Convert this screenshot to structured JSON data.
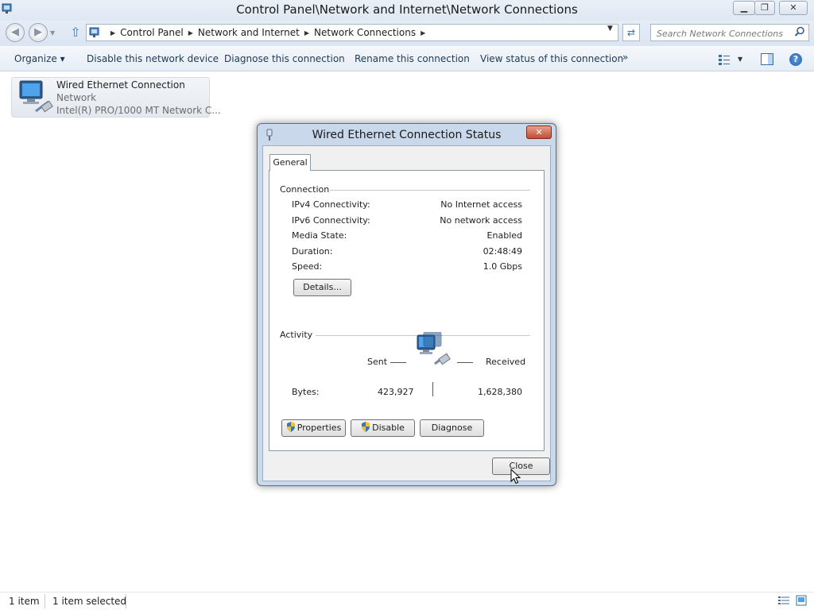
{
  "window": {
    "title": "Control Panel\\Network and Internet\\Network Connections",
    "min_glyph": "▁",
    "max_glyph": "❐",
    "close_glyph": "✕"
  },
  "address": {
    "crumbs": [
      "Control Panel",
      "Network and Internet",
      "Network Connections"
    ],
    "search_placeholder": "Search Network Connections"
  },
  "commands": {
    "organize": "Organize ▾",
    "disable": "Disable this network device",
    "diagnose": "Diagnose this connection",
    "rename": "Rename this connection",
    "view_status": "View status of this connection",
    "more": "»"
  },
  "network_item": {
    "name": "Wired Ethernet Connection",
    "type": "Network",
    "adapter": "Intel(R) PRO/1000 MT Network C..."
  },
  "dialog": {
    "title": "Wired Ethernet Connection Status",
    "tab": "General",
    "connection": {
      "label": "Connection",
      "rows": [
        {
          "label": "IPv4 Connectivity:",
          "value": "No Internet access"
        },
        {
          "label": "IPv6 Connectivity:",
          "value": "No network access"
        },
        {
          "label": "Media State:",
          "value": "Enabled"
        },
        {
          "label": "Duration:",
          "value": "02:48:49"
        },
        {
          "label": "Speed:",
          "value": "1.0 Gbps"
        }
      ],
      "details_button": "Details..."
    },
    "activity": {
      "label": "Activity",
      "sent_label": "Sent",
      "received_label": "Received",
      "bytes_label": "Bytes:",
      "bytes_sent": "423,927",
      "bytes_received": "1,628,380"
    },
    "buttons": {
      "properties": "Properties",
      "disable": "Disable",
      "diagnose": "Diagnose",
      "close": "Close"
    }
  },
  "statusbar": {
    "count": "1 item",
    "selected": "1 item selected"
  },
  "colors": {
    "command_text": "#1e3955",
    "dialog_frame": "#c9d8ea",
    "close_button_red": "#c24d36"
  }
}
